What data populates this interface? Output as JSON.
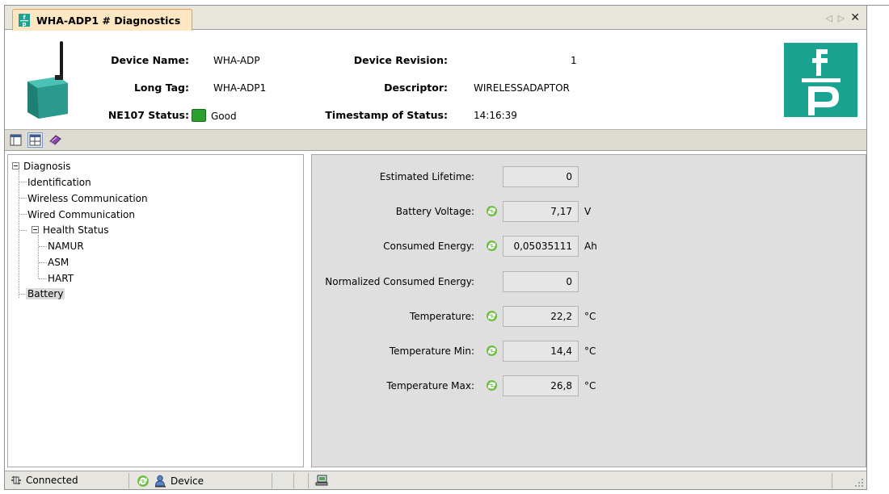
{
  "tab": {
    "title": "WHA-ADP1 # Diagnostics",
    "logo_glyph": "f̲p",
    "prev_glyph": "◁",
    "next_glyph": "▷",
    "close_glyph": "✕"
  },
  "header": {
    "device_name_label": "Device Name:",
    "device_name_value": "WHA-ADP",
    "long_tag_label": "Long Tag:",
    "long_tag_value": "WHA-ADP1",
    "ne107_label": "NE107 Status:",
    "ne107_value": "Good",
    "ne107_color": "#2aa12d",
    "revision_label": "Device Revision:",
    "revision_value": "1",
    "descriptor_label": "Descriptor:",
    "descriptor_value": "WIRELESSADAPTOR",
    "timestamp_label": "Timestamp of Status:",
    "timestamp_value": "14:16:39",
    "brand_color": "#1ba391"
  },
  "toolbar": {
    "buttons": [
      "layout-left-icon",
      "layout-split-icon",
      "book-icon"
    ]
  },
  "tree": {
    "root": "Diagnosis",
    "items": {
      "identification": "Identification",
      "wireless": "Wireless Communication",
      "wired": "Wired Communication",
      "health": "Health Status",
      "namur": "NAMUR",
      "asm": "ASM",
      "hart": "HART",
      "battery": "Battery"
    },
    "selected": "Battery"
  },
  "fields": {
    "estimated_lifetime": {
      "label": "Estimated Lifetime:",
      "value": "0",
      "unit": ""
    },
    "battery_voltage": {
      "label": "Battery Voltage:",
      "value": "7,17",
      "unit": "V"
    },
    "consumed_energy": {
      "label": "Consumed Energy:",
      "value": "0,05035111",
      "unit": "Ah"
    },
    "normalized_energy": {
      "label": "Normalized Consumed Energy:",
      "value": "0",
      "unit": ""
    },
    "temperature": {
      "label": "Temperature:",
      "value": "22,2",
      "unit": "°C"
    },
    "temperature_min": {
      "label": "Temperature Min:",
      "value": "14,4",
      "unit": "°C"
    },
    "temperature_max": {
      "label": "Temperature Max:",
      "value": "26,8",
      "unit": "°C"
    }
  },
  "statusbar": {
    "connected": "Connected",
    "device": "Device"
  }
}
